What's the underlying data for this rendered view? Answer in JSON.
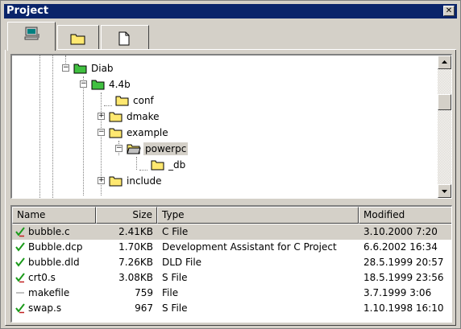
{
  "window": {
    "title": "Project",
    "close_glyph": "✕"
  },
  "tabs": [
    {
      "icon": "computer-icon"
    },
    {
      "icon": "folder-icon"
    },
    {
      "icon": "file-icon"
    }
  ],
  "tree": [
    {
      "label": "Diab",
      "toggle": "−"
    },
    {
      "label": "4.4b",
      "toggle": "−"
    },
    {
      "label": "conf",
      "toggle": ""
    },
    {
      "label": "dmake",
      "toggle": "+"
    },
    {
      "label": "example",
      "toggle": "−"
    },
    {
      "label": "powerpc",
      "toggle": "−",
      "selected": true
    },
    {
      "label": "_db",
      "toggle": ""
    },
    {
      "label": "include",
      "toggle": "+"
    }
  ],
  "list": {
    "columns": [
      "Name",
      "Size",
      "Type",
      "Modified"
    ],
    "rows": [
      {
        "status": "checked-out",
        "name": "bubble.c",
        "size": "2.41KB",
        "type": "C File",
        "modified": "3.10.2000 7:20",
        "selected": true
      },
      {
        "status": "checked-in",
        "name": "Bubble.dcp",
        "size": "1.70KB",
        "type": "Development Assistant for C Project",
        "modified": "6.6.2002 16:34"
      },
      {
        "status": "checked-in",
        "name": "bubble.dld",
        "size": "7.26KB",
        "type": "DLD File",
        "modified": "28.5.1999 20:57"
      },
      {
        "status": "checked-out",
        "name": "crt0.s",
        "size": "3.08KB",
        "type": "S File",
        "modified": "18.5.1999 23:56"
      },
      {
        "status": "none",
        "name": "makefile",
        "size": "759",
        "type": "File",
        "modified": "3.7.1999 3:06"
      },
      {
        "status": "checked-out",
        "name": "swap.s",
        "size": "967",
        "type": "S File",
        "modified": "1.10.1998 16:10"
      }
    ]
  },
  "colors": {
    "titlebar": "#0a246a",
    "check": "#1a9a1a",
    "folder": "#ffe870"
  }
}
